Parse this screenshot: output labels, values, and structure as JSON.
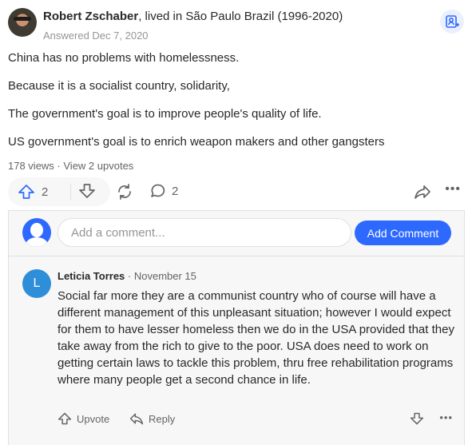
{
  "answer_header": {
    "author_name": "Robert Zschaber",
    "credential": ", lived in São Paulo Brazil (1996-2020)",
    "answered_date": "Answered Dec 7, 2020"
  },
  "answer_body": [
    "China has no problems with homelessness.",
    "Because it is a socialist country, solidarity,",
    "The government's goal is to improve people's quality of life.",
    "US government's goal is to enrich weapon makers and other gangsters"
  ],
  "meta": {
    "views": "178 views",
    "separator": " · ",
    "upvotes_link": "View 2 upvotes"
  },
  "actions": {
    "upvote_count": "2",
    "comment_count": "2",
    "more_glyph": "•••"
  },
  "comment_box": {
    "placeholder": "Add a comment...",
    "button_label": "Add Comment"
  },
  "comment": {
    "avatar_letter": "L",
    "author": "Leticia Torres",
    "date": " · November 15",
    "text": "Social far more they are a communist country who of course will have a different management of this unpleasant situation; however I would expect for them to have lesser homeless then we do in the USA provided that they take away from the rich to give to the poor. USA does need to work on getting certain laws to tackle this problem, thru free rehabilitation programs where many people get a second chance in life.",
    "upvote_label": "Upvote",
    "reply_label": "Reply",
    "more_glyph": "•••"
  },
  "colors": {
    "accent": "#2e69ff",
    "muted": "#636466",
    "comment_avatar": "#2e8ed8"
  }
}
